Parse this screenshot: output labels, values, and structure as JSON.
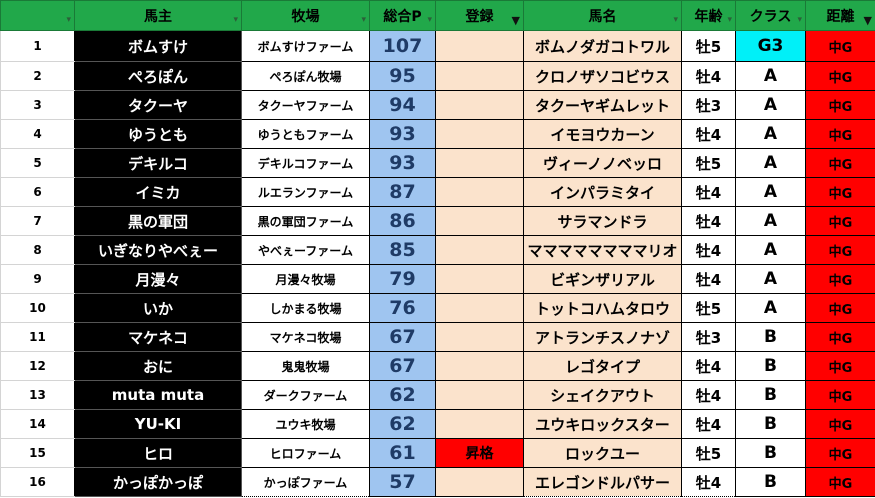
{
  "headers": {
    "blank": "",
    "owner": "馬主",
    "farm": "牧場",
    "points": "総合P",
    "registration": "登録",
    "horse": "馬名",
    "age": "年齢",
    "class": "クラス",
    "distance": "距離"
  },
  "rows": [
    {
      "n": "1",
      "owner": "ボムすけ",
      "farm": "ボムすけファーム",
      "points": "107",
      "reg": "",
      "horse": "ボムノダガコトワル",
      "age": "牡5",
      "cls": "G3",
      "dist": "中G"
    },
    {
      "n": "2",
      "owner": "ぺろぽん",
      "farm": "ぺろぽん牧場",
      "points": "95",
      "reg": "",
      "horse": "クロノザソコビウス",
      "age": "牡4",
      "cls": "A",
      "dist": "中G"
    },
    {
      "n": "3",
      "owner": "タクーヤ",
      "farm": "タクーヤファーム",
      "points": "94",
      "reg": "",
      "horse": "タクーヤギムレット",
      "age": "牡3",
      "cls": "A",
      "dist": "中G"
    },
    {
      "n": "4",
      "owner": "ゆうとも",
      "farm": "ゆうともファーム",
      "points": "93",
      "reg": "",
      "horse": "イモヨウカーン",
      "age": "牡4",
      "cls": "A",
      "dist": "中G"
    },
    {
      "n": "5",
      "owner": "デキルコ",
      "farm": "デキルコファーム",
      "points": "93",
      "reg": "",
      "horse": "ヴィーノノベッロ",
      "age": "牡5",
      "cls": "A",
      "dist": "中G"
    },
    {
      "n": "6",
      "owner": "イミカ",
      "farm": "ルエランファーム",
      "points": "87",
      "reg": "",
      "horse": "インパラミタイ",
      "age": "牡4",
      "cls": "A",
      "dist": "中G"
    },
    {
      "n": "7",
      "owner": "黒の軍団",
      "farm": "黒の軍団ファーム",
      "points": "86",
      "reg": "",
      "horse": "サラマンドラ",
      "age": "牡4",
      "cls": "A",
      "dist": "中G"
    },
    {
      "n": "8",
      "owner": "いぎなりやべぇー",
      "farm": "やべぇーファーム",
      "points": "85",
      "reg": "",
      "horse": "ママママママママリオ",
      "age": "牡4",
      "cls": "A",
      "dist": "中G"
    },
    {
      "n": "9",
      "owner": "月漫々",
      "farm": "月漫々牧場",
      "points": "79",
      "reg": "",
      "horse": "ビギンザリアル",
      "age": "牡4",
      "cls": "A",
      "dist": "中G"
    },
    {
      "n": "10",
      "owner": "いか",
      "farm": "しかまる牧場",
      "points": "76",
      "reg": "",
      "horse": "トットコハムタロウ",
      "age": "牡5",
      "cls": "A",
      "dist": "中G"
    },
    {
      "n": "11",
      "owner": "マケネコ",
      "farm": "マケネコ牧場",
      "points": "67",
      "reg": "",
      "horse": "アトランチスノナゾ",
      "age": "牡3",
      "cls": "B",
      "dist": "中G"
    },
    {
      "n": "12",
      "owner": "おに",
      "farm": "鬼鬼牧場",
      "points": "67",
      "reg": "",
      "horse": "レゴタイプ",
      "age": "牡4",
      "cls": "B",
      "dist": "中G"
    },
    {
      "n": "13",
      "owner": "muta muta",
      "farm": "ダークファーム",
      "points": "62",
      "reg": "",
      "horse": "シェイクアウト",
      "age": "牡4",
      "cls": "B",
      "dist": "中G"
    },
    {
      "n": "14",
      "owner": "YU-KI",
      "farm": "ユウキ牧場",
      "points": "62",
      "reg": "",
      "horse": "ユウキロックスター",
      "age": "牡4",
      "cls": "B",
      "dist": "中G"
    },
    {
      "n": "15",
      "owner": "ヒロ",
      "farm": "ヒロファーム",
      "points": "61",
      "reg": "昇格",
      "horse": "ロックユー",
      "age": "牡5",
      "cls": "B",
      "dist": "中G"
    },
    {
      "n": "16",
      "owner": "かっぽかっぽ",
      "farm": "かっぽファーム",
      "points": "57",
      "reg": "",
      "horse": "エレゴンドルパサー",
      "age": "牡4",
      "cls": "B",
      "dist": "中G"
    }
  ],
  "colors": {
    "header": "#21a84a",
    "owner_cell": "#000000",
    "points_cell": "#9fc5f0",
    "peach_cell": "#fbe3cc",
    "g3_class": "#00f0f8",
    "distance_cell": "#ff0000",
    "promotion_cell": "#ff0000"
  },
  "icons": {
    "filter": "filter-dropdown-icon",
    "filter_active": "filter-active-icon"
  }
}
